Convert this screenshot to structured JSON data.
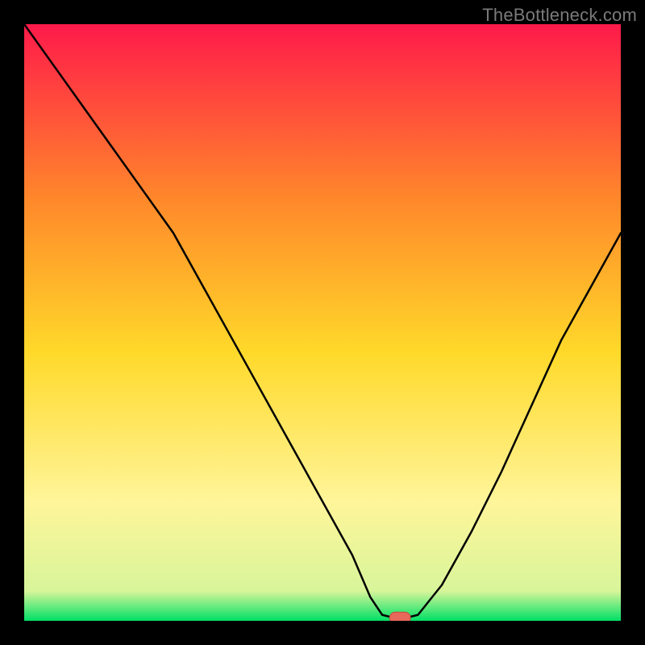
{
  "watermark": "TheBottleneck.com",
  "colors": {
    "bg": "#000000",
    "gradient_top": "#ff1a4a",
    "gradient_mid1": "#ff8a2a",
    "gradient_mid2": "#ffd92a",
    "gradient_mid3": "#fff59a",
    "gradient_green": "#00e066",
    "line": "#000000",
    "marker_fill": "#e8695a",
    "marker_stroke": "#c24a3c"
  },
  "chart_data": {
    "type": "line",
    "title": "",
    "xlabel": "",
    "ylabel": "",
    "xlim": [
      0,
      100
    ],
    "ylim": [
      0,
      100
    ],
    "grid": false,
    "legend": false,
    "series": [
      {
        "name": "bottleneck-curve",
        "x": [
          0,
          5,
          10,
          15,
          20,
          25,
          30,
          35,
          40,
          45,
          50,
          55,
          58,
          60,
          62,
          64,
          66,
          70,
          75,
          80,
          85,
          90,
          95,
          100
        ],
        "y": [
          100,
          93,
          86,
          79,
          72,
          65,
          56,
          47,
          38,
          29,
          20,
          11,
          4,
          1,
          0.5,
          0.5,
          1,
          6,
          15,
          25,
          36,
          47,
          56,
          65
        ]
      }
    ],
    "marker": {
      "x": 63,
      "y": 0.5
    },
    "annotations": []
  }
}
